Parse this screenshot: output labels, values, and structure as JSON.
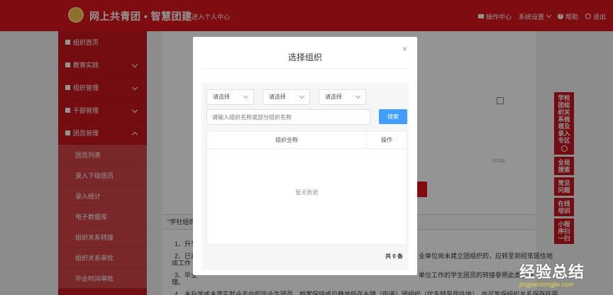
{
  "header": {
    "brand": "网上共青团 • 智慧团建",
    "enter_center": "进入个人中心",
    "nav": {
      "ops_center": "操作中心",
      "settings": "系统设置",
      "help": "帮助",
      "logout": "退出"
    }
  },
  "sidebar": {
    "items": [
      {
        "label": "组织首页",
        "icon": "home-icon"
      },
      {
        "label": "教育实践",
        "icon": "edit-icon"
      },
      {
        "label": "组织管理",
        "icon": "org-icon"
      },
      {
        "label": "干部管理",
        "icon": "cadre-icon"
      },
      {
        "label": "团员管理",
        "icon": "member-icon"
      }
    ],
    "sub_items": [
      "团员列表",
      "录入下级团员",
      "录入统计",
      "电子数据库",
      "组织关系转接",
      "组织关系审批",
      "毕业时间审批"
    ]
  },
  "content": {
    "counter": "0/100",
    "tip_title": "\"学社组织\"",
    "tip_lines": [
      "1、升学",
      "2、已离",
      "成工作",
      "3、毕业",
      "理。",
      "4、未升学或未落实就业去向的毕业生团员，档案保持或户籍地所在乡镇（街道）团组织（优先转至居住地），也可暂保组织关系保存在原"
    ],
    "tip_right_1": "业单位尚未建立团组织的，应转至到经常居住地",
    "tip_right_2": "单位工作的学生团员的转接参照此类型办"
  },
  "float_buttons": [
    "学校团组织关系梳理及录入专区",
    "全局搜索",
    "常见问题",
    "在线培训",
    "小程序扫一扫"
  ],
  "modal": {
    "title": "选择组织",
    "close": "×",
    "selects": [
      "请选择",
      "请选择",
      "请选择"
    ],
    "search": {
      "placeholder": "请输入组织名称或部分组织名称",
      "button": "搜索"
    },
    "table": {
      "columns": [
        "组织全称",
        "操作"
      ],
      "empty_text": "暂无数据"
    },
    "total": "共 0 条"
  },
  "watermark": {
    "main": "经验总结",
    "sub": "jingyanzongjie.com"
  }
}
